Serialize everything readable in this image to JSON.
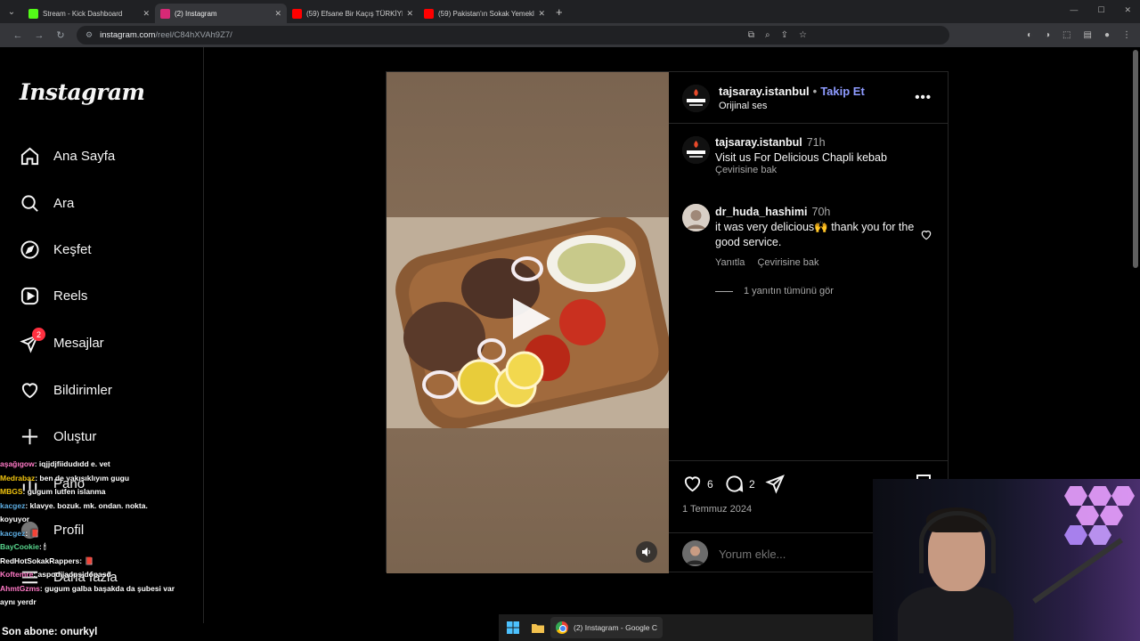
{
  "browser": {
    "tabs": [
      {
        "title": "Stream - Kick Dashboard",
        "favicon_color": "#53fc18",
        "active": false
      },
      {
        "title": "(2) Instagram",
        "favicon_color": "#d62976",
        "active": true
      },
      {
        "title": "(59) Efsane Bir Kaçış TÜRKİYE'D",
        "favicon_color": "#ff0000",
        "active": false
      },
      {
        "title": "(59) Pakistan'ın Sokak Yemekle",
        "favicon_color": "#ff0000",
        "active": false
      }
    ],
    "url_host": "instagram.com",
    "url_path": "/reel/C84hXVAh9Z7/"
  },
  "sidebar": {
    "logo": "Instagram",
    "items": [
      {
        "label": "Ana Sayfa",
        "icon": "home-icon"
      },
      {
        "label": "Ara",
        "icon": "search-icon"
      },
      {
        "label": "Keşfet",
        "icon": "explore-icon"
      },
      {
        "label": "Reels",
        "icon": "reels-icon"
      },
      {
        "label": "Mesajlar",
        "icon": "messenger-icon",
        "badge": "2"
      },
      {
        "label": "Bildirimler",
        "icon": "heart-icon"
      },
      {
        "label": "Oluştur",
        "icon": "plus-icon"
      },
      {
        "label": "Pano",
        "icon": "dashboard-icon"
      },
      {
        "label": "Profil",
        "icon": "profile-icon"
      },
      {
        "label": "Daha fazla",
        "icon": "menu-icon"
      }
    ]
  },
  "post": {
    "username": "tajsaray.istanbul",
    "dot": "•",
    "follow": "Takip Et",
    "audio": "Orijinal ses",
    "more": "•••",
    "caption": {
      "username": "tajsaray.istanbul",
      "time": "71h",
      "text": "Visit us For Delicious Chapli kebab",
      "translate": "Çevirisine bak"
    },
    "comment": {
      "username": "dr_huda_hashimi",
      "time": "70h",
      "text": "it was very delicious🙌 thank you for the good service.",
      "reply": "Yanıtla",
      "translate": "Çevirisine bak",
      "view_replies": "1 yanıtın tümünü gör"
    },
    "likes": "6",
    "comments_count": "2",
    "date": "1 Temmuz 2024",
    "comment_placeholder": "Yorum ekle..."
  },
  "chat": [
    {
      "name": "aşağıgow",
      "msg": ": iqjjdjfiidudıdd e. vet",
      "cls": "n"
    },
    {
      "name": "Medrabaz",
      "msg": ": ben de yakışıklıyım gugu",
      "cls": "n2"
    },
    {
      "name": "MBGS",
      "msg": ": gugum lutfen islanma",
      "cls": "n2"
    },
    {
      "name": "kacgez",
      "msg": ": klavye. bozuk. mk. ondan. nokta.",
      "cls": "n3"
    },
    {
      "name": "koyuyor",
      "msg": "",
      "cls": ""
    },
    {
      "name": "kacgez",
      "msg": ": 📕",
      "cls": "n3"
    },
    {
      "name": "BayCookie",
      "msg": ": 🕯",
      "cls": "n4"
    },
    {
      "name": "RedHotSokakRappers",
      "msg": ": 📕",
      "cls": ""
    },
    {
      "name": "Koftemre",
      "msg": ": aspodijaopsjdopasd",
      "cls": "n"
    },
    {
      "name": "AhmtGzms",
      "msg": ": gugum galba başakda da şubesi var",
      "cls": "n"
    },
    {
      "name": "aynı yerdr",
      "msg": "",
      "cls": ""
    }
  ],
  "stream": {
    "subscriber_label": "Son abone: onurkyl"
  },
  "taskbar": {
    "chrome_title": "(2) Instagram - Google C"
  }
}
